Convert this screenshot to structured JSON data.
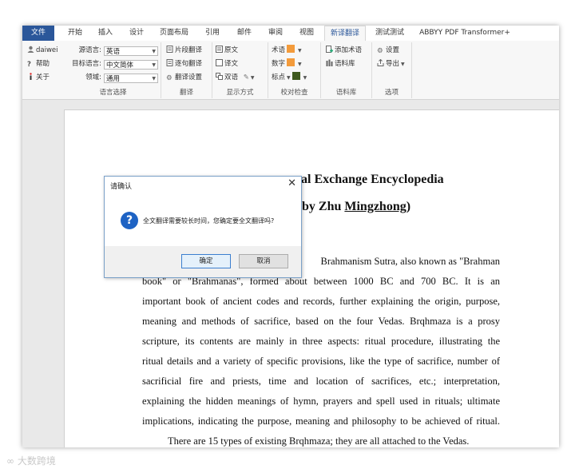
{
  "tabs": [
    "文件",
    "开始",
    "插入",
    "设计",
    "页面布局",
    "引用",
    "邮件",
    "审阅",
    "视图",
    "新译翻译",
    "测试测试",
    "ABBYY PDF Transformer+"
  ],
  "ribbon": {
    "account": {
      "user": "daiwei",
      "help": "帮助",
      "about": "关于"
    },
    "language_group": {
      "label": "语言选择",
      "source_label": "源语言:",
      "source_value": "英语",
      "target_label": "目标语言:",
      "target_value": "中文简体",
      "domain_label": "领域:",
      "domain_value": "通用"
    },
    "translate_group": {
      "label": "翻译",
      "segment": "片段翻译",
      "sentence": "逐句翻译",
      "settings": "翻译设置"
    },
    "display_group": {
      "label": "显示方式",
      "original": "原文",
      "translation": "译文",
      "bilingual": "双语"
    },
    "proof_group": {
      "label": "校对检查",
      "terms": "术语",
      "numbers": "数字",
      "punct": "标点",
      "term_color": "#f39b3b",
      "number_color": "#f39b3b",
      "punct_color": "#3f5a1e"
    },
    "corpus_group": {
      "label": "语料库",
      "add_term": "添加术语",
      "corpus": "语料库"
    },
    "options_group": {
      "label": "选项",
      "settings": "设置",
      "export": "导出"
    }
  },
  "document": {
    "title1": "al Exchange Encyclopedia",
    "title2_pre": "by Zhu ",
    "title2_name": "Mingzhong",
    "title2_post": ")",
    "lines": [
      "Brahmanism Sutra, also known as \"Brahman",
      "book\" or \"Brahmanas\", formed about between 1000 BC and 700 BC. It is an",
      "important book of ancient codes and records, further explaining the origin, purpose,",
      "meaning and methods of sacrifice, based on the four Vedas. Brqhmaza is a prosy",
      "scripture, its contents are mainly in three aspects: ritual procedure, illustrating the",
      "ritual details and a variety of specific provisions, like the type of sacrifice, number of",
      "sacrificial fire and priests, time and location of sacrifices, etc.; interpretation,",
      "explaining the hidden meanings of hymn, prayers and spell used in rituals; ultimate",
      "implications, indicating the purpose, meaning and philosophy to be achieved of ritual.",
      "There are 15 types of existing Brqhmaza; they are all attached to the Vedas."
    ]
  },
  "dialog": {
    "title": "请确认",
    "message": "全文翻译需要较长时间，您确定要全文翻译吗?",
    "ok": "确定",
    "cancel": "取消"
  },
  "watermark": "大数跨境"
}
